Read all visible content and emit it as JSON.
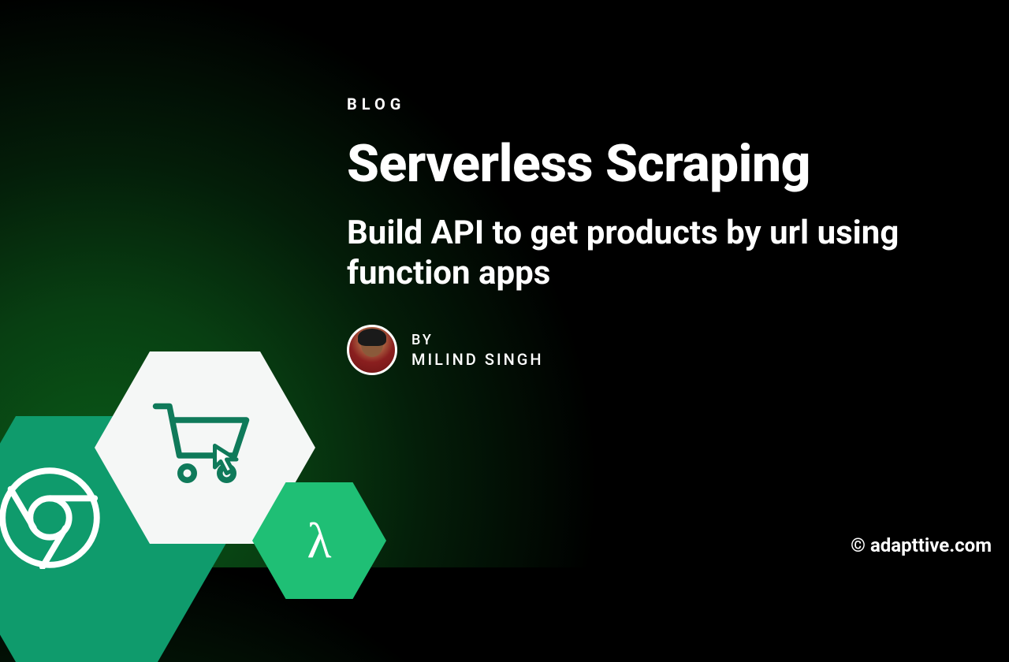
{
  "kicker": "BLOG",
  "title": "Serverless Scraping",
  "subtitle": "Build API to get products by url using function apps",
  "byline": {
    "label": "BY",
    "author": "MILIND SINGH"
  },
  "copyright": "© adapttive.com",
  "icons": {
    "chrome": "chrome-icon",
    "cart": "shopping-cart-icon",
    "lambda": "lambda-icon"
  }
}
